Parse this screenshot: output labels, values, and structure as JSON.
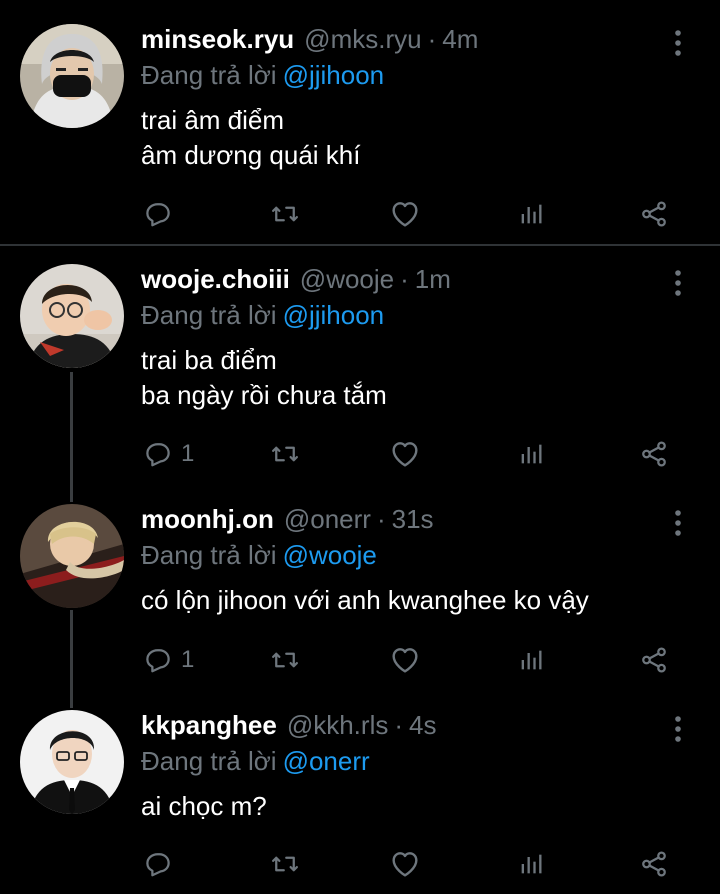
{
  "reply_prefix": "Đang trả lời",
  "colors": {
    "background": "#000000",
    "secondary_text": "#6e767d",
    "link": "#1d9bf0",
    "thread_line": "#3a3d40"
  },
  "tweets": [
    {
      "name": "minseok.ryu",
      "handle": "@mks.ryu",
      "separator": "·",
      "time": "4m",
      "reply_to": "@jjihoon",
      "lines": [
        "trai âm điểm",
        "âm dương quái khí"
      ],
      "reply_count": "",
      "avatar": "avatar-masked-man"
    },
    {
      "name": "wooje.choiii",
      "handle": "@wooje",
      "separator": "·",
      "time": "1m",
      "reply_to": "@jjihoon",
      "lines": [
        "trai ba điểm",
        "ba ngày rồi chưa tắm"
      ],
      "reply_count": "1",
      "avatar": "avatar-man-glasses"
    },
    {
      "name": "moonhj.on",
      "handle": "@onerr",
      "separator": "·",
      "time": "31s",
      "reply_to": "@wooje",
      "lines": [
        "có lộn jihoon với anh kwanghee ko vậy"
      ],
      "reply_count": "1",
      "avatar": "avatar-blonde-man"
    },
    {
      "name": "kkpanghee",
      "handle": "@kkh.rls",
      "separator": "·",
      "time": "4s",
      "reply_to": "@onerr",
      "lines": [
        "ai chọc m?"
      ],
      "reply_count": "",
      "avatar": "avatar-man-suit"
    }
  ],
  "icons": {
    "reply": "reply-icon",
    "retweet": "retweet-icon",
    "like": "like-icon",
    "views": "views-icon",
    "share": "share-icon",
    "more": "more-icon"
  }
}
